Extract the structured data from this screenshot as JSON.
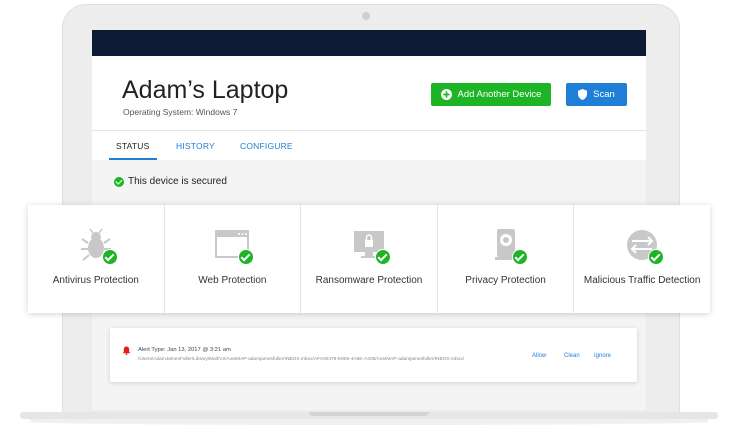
{
  "device": {
    "name": "Adam’s Laptop",
    "os": "Operating System: Windows 7"
  },
  "actions": {
    "add_device": "Add Another Device",
    "scan": "Scan"
  },
  "tabs": [
    {
      "label": "STATUS"
    },
    {
      "label": "HISTORY"
    },
    {
      "label": "CONFIGURE"
    }
  ],
  "status": {
    "message": "This device is secured"
  },
  "protections": [
    {
      "label": "Antivirus Protection",
      "icon": "bug-icon"
    },
    {
      "label": "Web Protection",
      "icon": "browser-window-icon"
    },
    {
      "label": "Ransomware Protection",
      "icon": "locked-monitor-icon"
    },
    {
      "label": "Privacy Protection",
      "icon": "webcam-icon"
    },
    {
      "label": "Malicious Traffic Detection",
      "icon": "traffic-arrows-icon"
    }
  ],
  "alert": {
    "type": "Alert Type: Jan 13, 2017 @ 3:21 am",
    "path": "/Users/AdamJamesFuller/Library/Mail/V2/AosIMAP-adamjamesfuller/INBOX.mbox/AFA00479-E808-4A6E-A405/AosIMAP-adamjamesfuller/INBOX.mbox/",
    "actions": {
      "allow": "Allow",
      "clean": "Clean",
      "ignore": "Ignore"
    }
  },
  "colors": {
    "topbar": "#0d1a33",
    "accent_green": "#1db526",
    "accent_blue": "#1f7fd6",
    "alert_red": "#e02020"
  }
}
